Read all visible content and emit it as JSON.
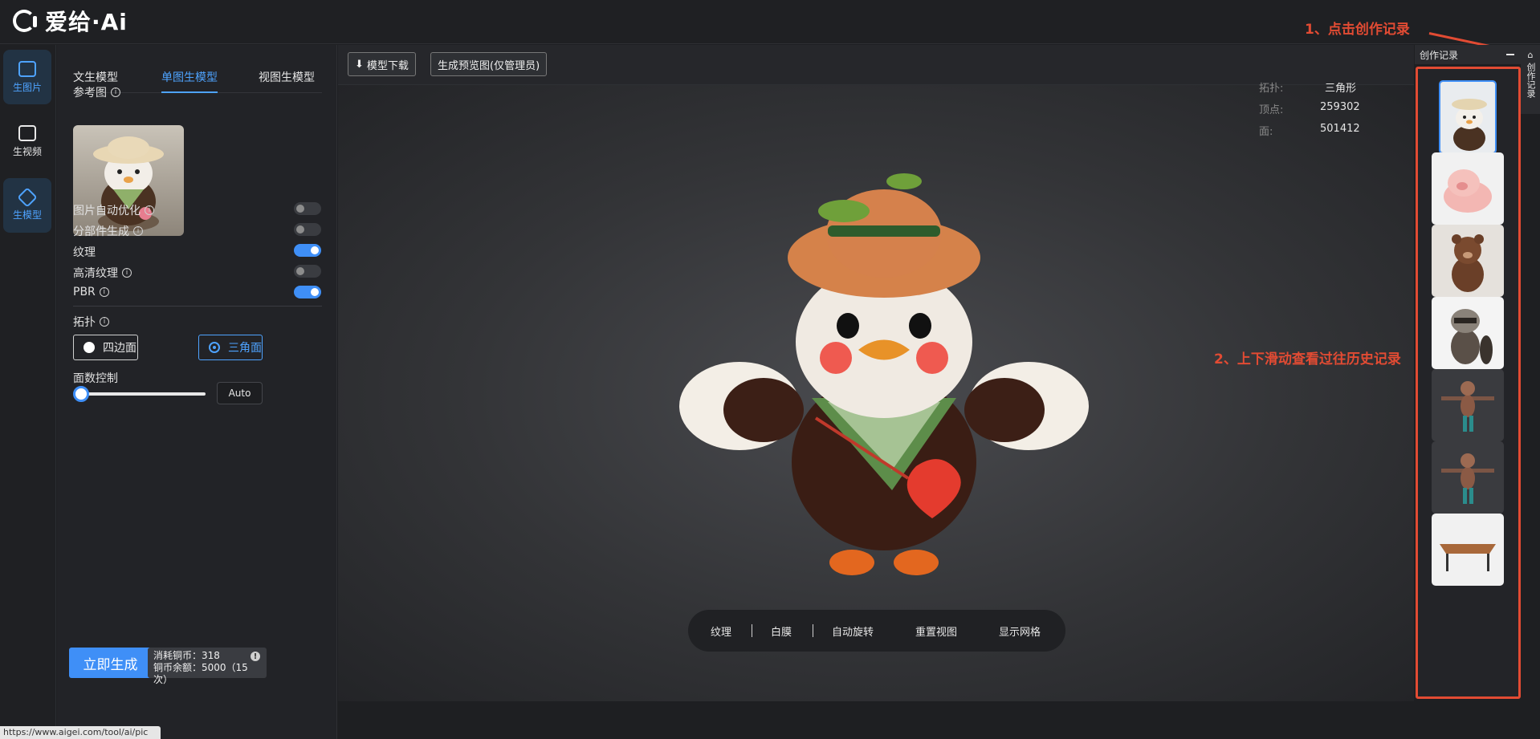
{
  "app": {
    "logo_text": "爱给·Ai"
  },
  "annotations": {
    "step1": "1、点击创作记录",
    "step2": "2、上下滑动查看过往历史记录"
  },
  "rail": [
    {
      "label": "生图片"
    },
    {
      "label": "生视频"
    },
    {
      "label": "生模型"
    }
  ],
  "panel": {
    "tabs": [
      "文生模型",
      "单图生模型",
      "视图生模型"
    ],
    "ref_label": "参考图",
    "options": [
      {
        "label": "图片自动优化",
        "on": false
      },
      {
        "label": "分部件生成",
        "on": false
      },
      {
        "label": "纹理",
        "on": true
      },
      {
        "label": "高清纹理",
        "on": false
      },
      {
        "label": "PBR",
        "on": true
      }
    ],
    "topology_label": "拓扑",
    "topology_options": [
      "四边面",
      "三角面"
    ],
    "topology_selected": "三角面",
    "face_count_label": "面数控制",
    "face_count_value": 0,
    "auto_label": "Auto",
    "generate_label": "立即生成",
    "cost_line": "消耗铜币：318",
    "balance_line": "铜币余额：5000（15次）"
  },
  "status_url": "https://www.aigei.com/tool/ai/pic",
  "toolbar": {
    "download_label": "模型下载",
    "preview_label": "生成预览图(仅管理员)"
  },
  "stats": [
    {
      "label": "拓扑:",
      "value": "三角形"
    },
    {
      "label": "顶点:",
      "value": "259302"
    },
    {
      "label": "面:",
      "value": "501412"
    }
  ],
  "bottom_bar": [
    "纹理",
    "白膜",
    "自动旋转",
    "重置视图",
    "显示网格"
  ],
  "history": {
    "title": "创作记录",
    "side_tab": "创作记录",
    "items": [
      "chick",
      "pig",
      "bear",
      "raccoon",
      "monkey-a",
      "monkey-b",
      "table"
    ]
  }
}
